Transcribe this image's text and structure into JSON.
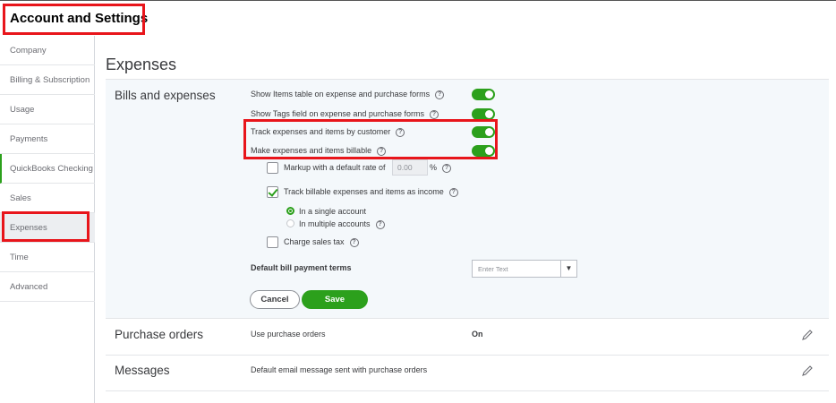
{
  "header": {
    "title": "Account and Settings"
  },
  "sidebar": {
    "items": [
      {
        "label": "Company"
      },
      {
        "label": "Billing & Subscription"
      },
      {
        "label": "Usage"
      },
      {
        "label": "Payments"
      },
      {
        "label": "QuickBooks Checking"
      },
      {
        "label": "Sales"
      },
      {
        "label": "Expenses"
      },
      {
        "label": "Time"
      },
      {
        "label": "Advanced"
      }
    ]
  },
  "page": {
    "title": "Expenses"
  },
  "bills": {
    "title": "Bills and expenses",
    "show_items": "Show Items table on expense and purchase forms",
    "show_tags": "Show Tags field on expense and purchase forms",
    "track_customer": "Track expenses and items by customer",
    "billable": "Make expenses and items billable",
    "markup": "Markup with a default rate of",
    "markup_value": "0.00",
    "percent": "%",
    "track_income": "Track billable expenses and items as income",
    "single_account": "In a single account",
    "multiple_accounts": "In multiple accounts",
    "sales_tax": "Charge sales tax",
    "payment_terms": "Default bill payment terms",
    "payment_terms_placeholder": "Enter Text",
    "cancel": "Cancel",
    "save": "Save"
  },
  "purchase_orders": {
    "title": "Purchase orders",
    "label": "Use purchase orders",
    "value": "On"
  },
  "messages": {
    "title": "Messages",
    "label": "Default email message sent with purchase orders"
  },
  "colors": {
    "accent": "#2ca01c",
    "highlight": "#e8151b"
  },
  "icons": {
    "help": "help-circle-icon",
    "edit": "pencil-icon",
    "dropdown": "caret-down-icon"
  }
}
